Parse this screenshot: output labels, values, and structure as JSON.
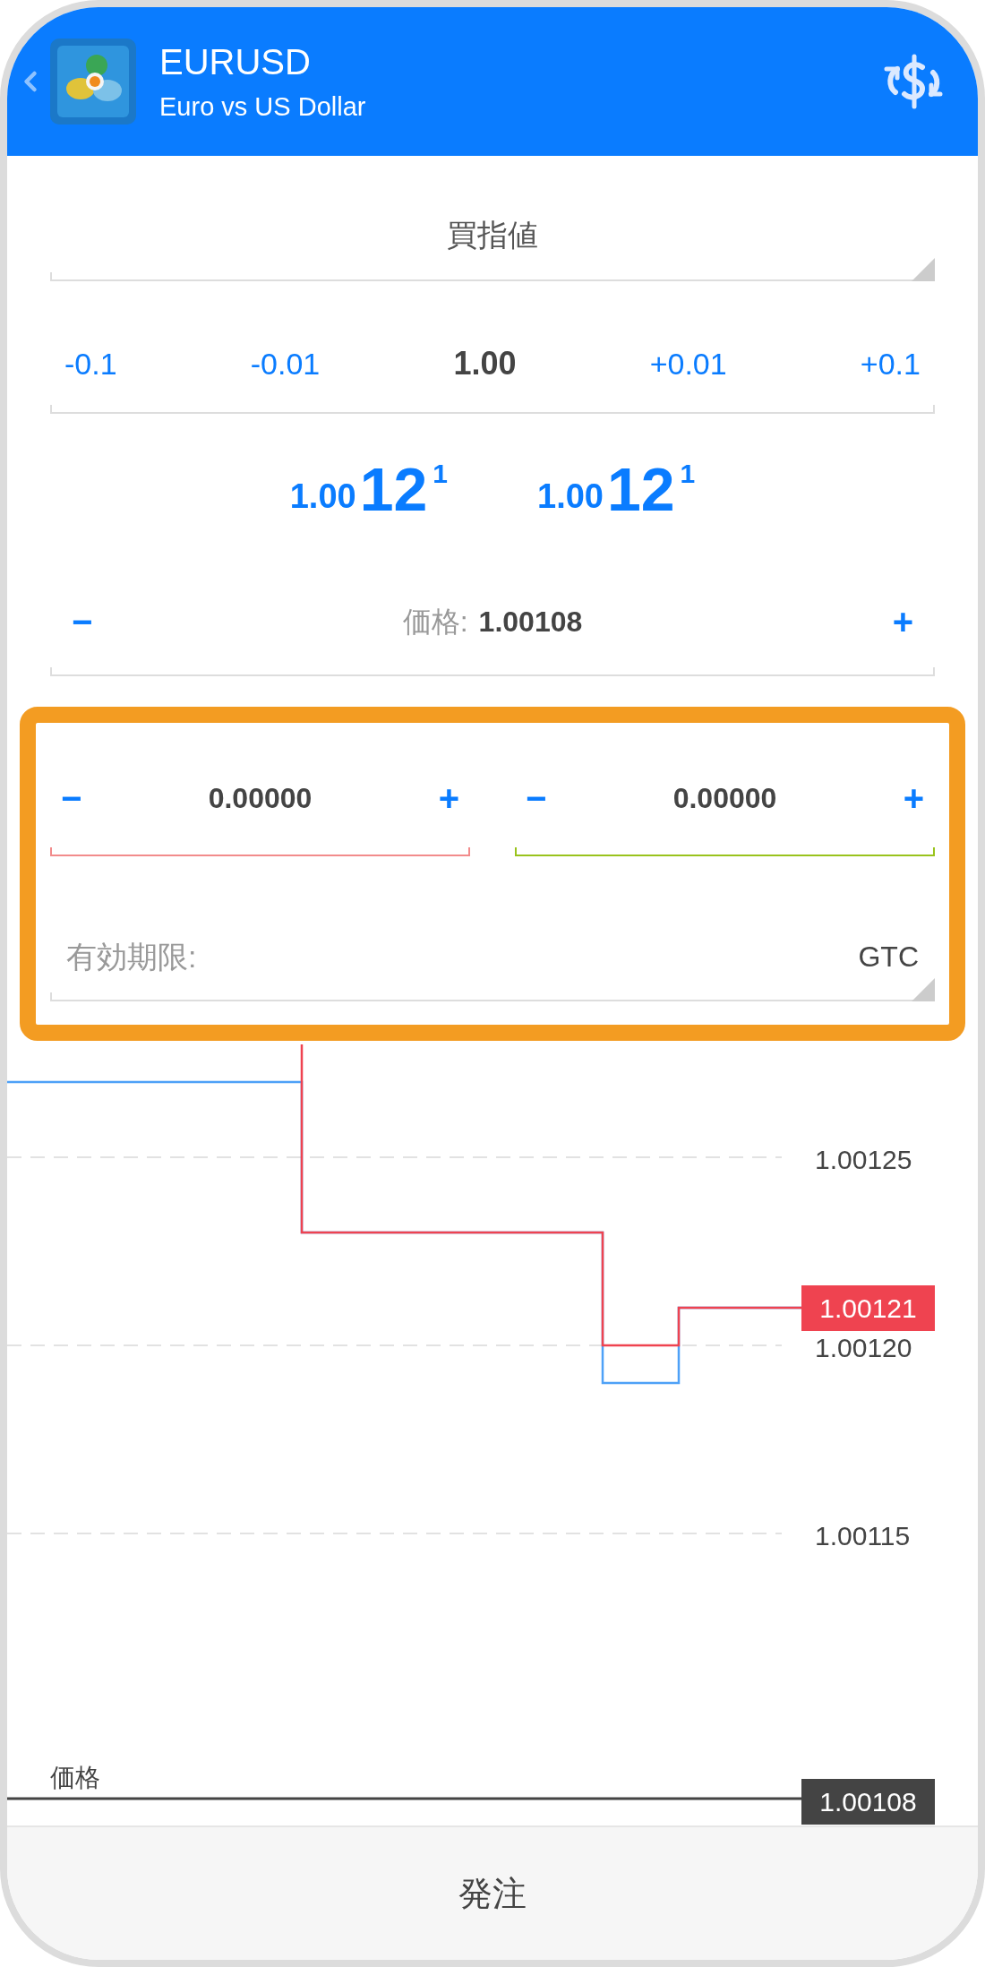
{
  "header": {
    "symbol": "EURUSD",
    "description": "Euro vs US Dollar"
  },
  "order_type": "買指値",
  "volume_steps": [
    {
      "label": "-0.1",
      "kind": "step"
    },
    {
      "label": "-0.01",
      "kind": "step"
    },
    {
      "label": "1.00",
      "kind": "value"
    },
    {
      "label": "+0.01",
      "kind": "step"
    },
    {
      "label": "+0.1",
      "kind": "step"
    }
  ],
  "quotes": [
    {
      "prefix": "1.00",
      "big": "12",
      "pip": "1"
    },
    {
      "prefix": "1.00",
      "big": "12",
      "pip": "1"
    }
  ],
  "price": {
    "minus": "−",
    "label": "価格:",
    "value": "1.00108",
    "plus": "+"
  },
  "stop_section": {
    "highlighted": true,
    "levels": [
      {
        "minus": "−",
        "value": "0.00000",
        "plus": "+",
        "color": "#f28b8b"
      },
      {
        "minus": "−",
        "value": "0.00000",
        "plus": "+",
        "color": "#99c31c"
      }
    ],
    "expiry": {
      "label": "有効期限:",
      "value": "GTC"
    }
  },
  "chart": {
    "price_scale": [
      "1.00125",
      "1.00120",
      "1.00115"
    ],
    "bid_tag": "1.00121",
    "order_line": {
      "label": "価格",
      "price": "1.00108"
    }
  },
  "footer": {
    "button": "発注"
  }
}
